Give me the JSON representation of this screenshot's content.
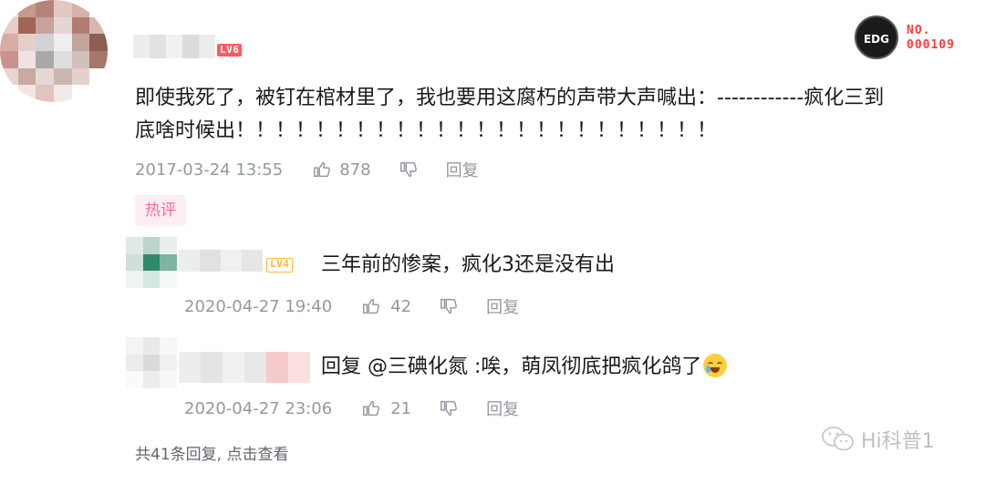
{
  "main_comment": {
    "level_badge": "LV6",
    "text": "即使我死了，被钉在棺材里了，我也要用这腐朽的声带大声喊出：------------疯化三到底啥时候出！！！！！！！！！！！！！！！！！！！！！！！！",
    "text_line1": "即使我死了，被钉在棺材里了，我也要用这腐朽的声带大声喊出：------------疯化三到",
    "text_line2": "底啥时候出！！！！！！！！！！！！！！！！！！！！！！！！",
    "timestamp": "2017-03-24 13:55",
    "like_count": "878",
    "reply_label": "回复",
    "hot_tag": "热评",
    "badge_logo": "EDG",
    "badge_no": "NO.",
    "badge_number": "000109"
  },
  "replies": [
    {
      "level_badge": "LV4",
      "text": "三年前的惨案，疯化3还是没有出",
      "timestamp": "2020-04-27 19:40",
      "like_count": "42",
      "reply_label": "回复"
    },
    {
      "text": "回复 @三碘化氮 :唉，萌凤彻底把疯化鸽了",
      "timestamp": "2020-04-27 23:06",
      "like_count": "21",
      "reply_label": "回复"
    }
  ],
  "more_replies": "共41条回复, 点击查看",
  "watermark": "Hi科普1",
  "icons": [
    "thumbs-up-icon",
    "thumbs-down-icon",
    "crying-laugh-emoji",
    "wechat-icon"
  ],
  "colors": {
    "text": "#18191c",
    "meta": "#9499a0",
    "hot_tag_bg": "#fdeef3",
    "hot_tag_text": "#ff6699",
    "lv6": "#ff5a5f",
    "lv4": "#f6b83c"
  }
}
